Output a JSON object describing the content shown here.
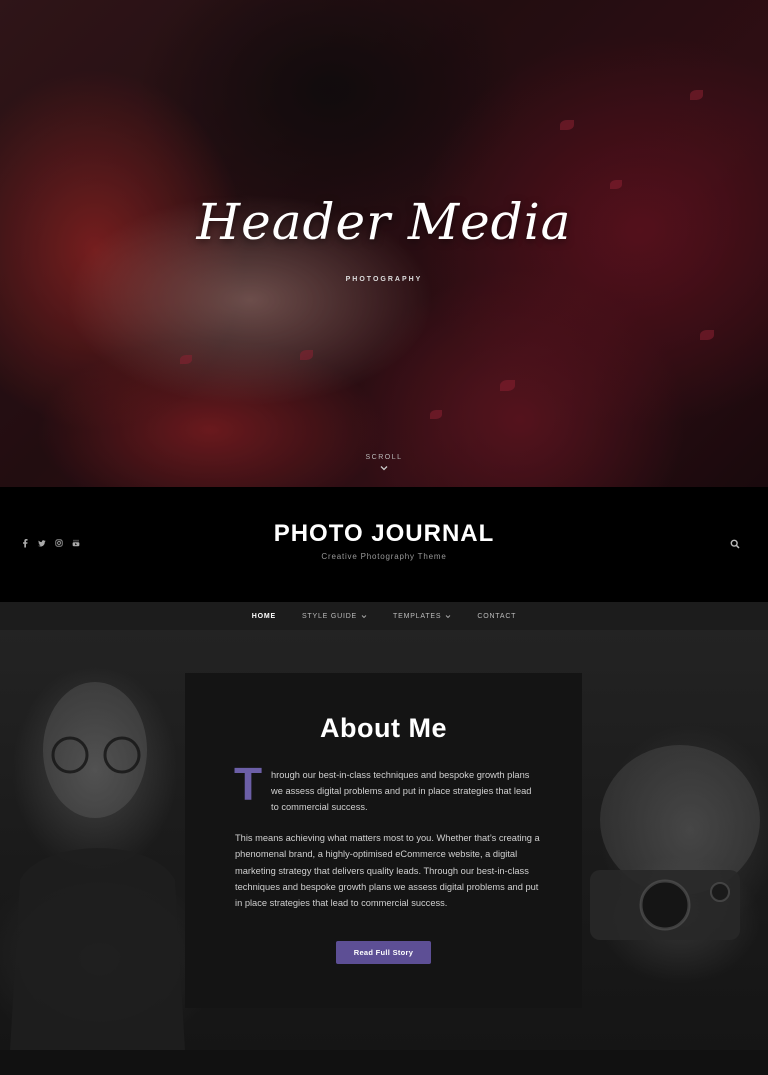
{
  "hero": {
    "title": "Header Media",
    "subtitle": "PHOTOGRAPHY",
    "scroll_label": "SCROLL"
  },
  "header": {
    "site_title": "PHOTO JOURNAL",
    "tagline": "Creative Photography Theme",
    "social": [
      "facebook-icon",
      "twitter-icon",
      "instagram-icon",
      "youtube-icon"
    ],
    "search_icon": "search-icon"
  },
  "nav": {
    "items": [
      {
        "label": "HOME",
        "active": true
      },
      {
        "label": "STYLE GUIDE",
        "dropdown": true
      },
      {
        "label": "TEMPLATES",
        "dropdown": true
      },
      {
        "label": "CONTACT"
      }
    ]
  },
  "about": {
    "title": "About Me",
    "dropcap": "T",
    "paragraph1": "hrough our best-in-class techniques and bespoke growth plans we assess digital problems and put in place strategies that lead to commercial success.",
    "paragraph2": "This means achieving what matters most to you. Whether that’s creating a phenomenal brand, a highly-optimised eCommerce website, a digital marketing strategy that delivers quality leads. Through our best-in-class techniques and bespoke growth plans we assess digital problems and put in place strategies that lead to commercial success.",
    "button_label": "Read Full Story"
  },
  "colors": {
    "accent": "#5d4f95",
    "dropcap": "#6c5fa7",
    "header_bg": "#000000",
    "nav_bg": "#1c1c1c",
    "card_bg": "#141414"
  }
}
